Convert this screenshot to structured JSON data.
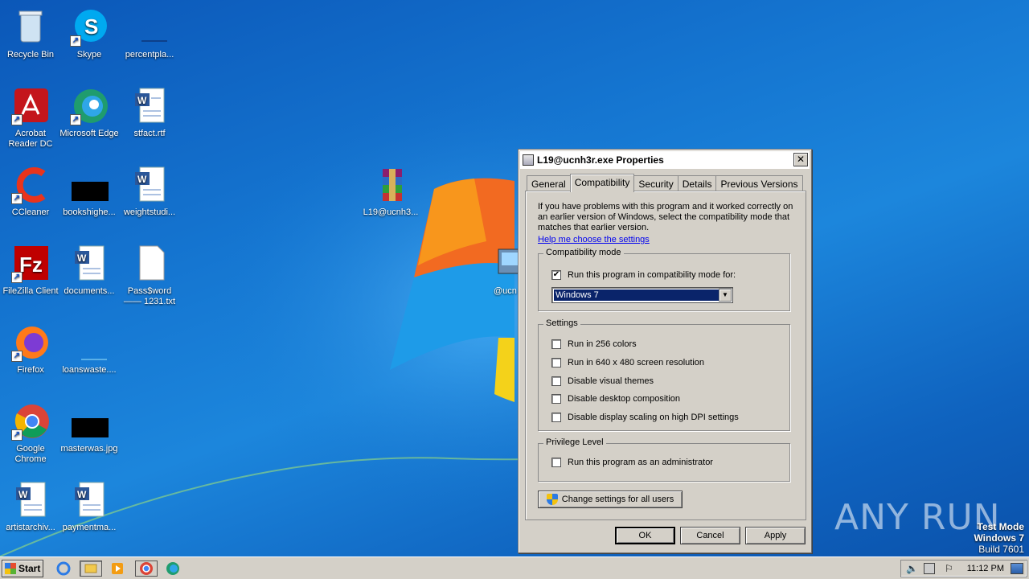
{
  "desktop": {
    "icons": [
      {
        "label": "Recycle Bin",
        "icon": "recycle-bin-icon"
      },
      {
        "label": "Skype",
        "icon": "skype-icon"
      },
      {
        "label": "percentpla...",
        "icon": "blank-file-icon"
      },
      {
        "label": "Acrobat Reader DC",
        "icon": "acrobat-icon"
      },
      {
        "label": "Microsoft Edge",
        "icon": "edge-icon"
      },
      {
        "label": "stfact.rtf",
        "icon": "word-doc-icon"
      },
      {
        "label": "CCleaner",
        "icon": "ccleaner-icon"
      },
      {
        "label": "bookshighe...",
        "icon": "black-image-icon"
      },
      {
        "label": "weightstudi...",
        "icon": "word-doc-icon"
      },
      {
        "label": "FileZilla Client",
        "icon": "filezilla-icon"
      },
      {
        "label": "documents...",
        "icon": "word-doc-icon"
      },
      {
        "label": "Pass$word —— 1231.txt",
        "icon": "text-file-icon"
      },
      {
        "label": "Firefox",
        "icon": "firefox-icon"
      },
      {
        "label": "loanswaste....",
        "icon": "blank-file-icon"
      },
      {
        "label": "Google Chrome",
        "icon": "chrome-icon"
      },
      {
        "label": "masterwas.jpg",
        "icon": "black-image-icon"
      },
      {
        "label": "artistarchiv...",
        "icon": "word-doc-icon"
      },
      {
        "label": "paymentma...",
        "icon": "word-doc-icon"
      },
      {
        "label": "L19@ucnh3...",
        "icon": "winrar-icon"
      },
      {
        "label": "@ucn",
        "icon": "installer-icon"
      }
    ]
  },
  "dialog": {
    "title": "L19@ucnh3r.exe Properties",
    "close": "✕",
    "tabs": [
      "General",
      "Compatibility",
      "Security",
      "Details",
      "Previous Versions"
    ],
    "active_tab": "Compatibility",
    "intro": "If you have problems with this program and it worked correctly on an earlier version of Windows, select the compatibility mode that matches that earlier version.",
    "help_link": "Help me choose the settings",
    "compat_group": {
      "legend": "Compatibility mode",
      "checkbox_label": "Run this program in compatibility mode for:",
      "checked": true,
      "selected_os": "Windows 7"
    },
    "settings_group": {
      "legend": "Settings",
      "options": [
        {
          "label": "Run in 256 colors",
          "checked": false
        },
        {
          "label": "Run in 640 x 480 screen resolution",
          "checked": false
        },
        {
          "label": "Disable visual themes",
          "checked": false
        },
        {
          "label": "Disable desktop composition",
          "checked": false
        },
        {
          "label": "Disable display scaling on high DPI settings",
          "checked": false
        }
      ]
    },
    "privilege_group": {
      "legend": "Privilege Level",
      "option": "Run this program as an administrator",
      "checked": false
    },
    "change_all_users": "Change settings for all users",
    "buttons": {
      "ok": "OK",
      "cancel": "Cancel",
      "apply": "Apply"
    }
  },
  "taskbar": {
    "start": "Start",
    "clock": "11:12 PM"
  },
  "watermark": {
    "line1": "Test Mode",
    "line2": "Windows 7",
    "line3": "Build 7601",
    "brand": "ANY RUN"
  }
}
